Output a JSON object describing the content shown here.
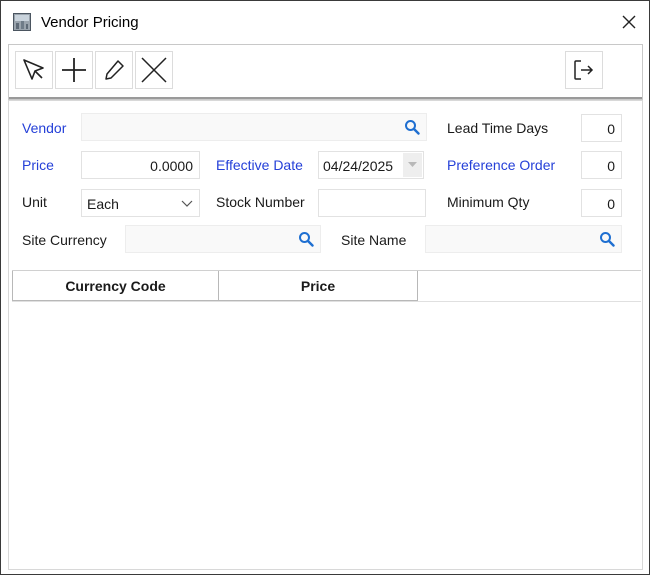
{
  "window": {
    "title": "Vendor Pricing"
  },
  "toolbar": {
    "icons": [
      "select-arrow-icon",
      "plus-icon",
      "pencil-icon",
      "x-delete-icon",
      "exit-icon"
    ]
  },
  "form": {
    "vendor": {
      "label": "Vendor",
      "value": ""
    },
    "lead_time_days": {
      "label": "Lead Time Days",
      "value": "0"
    },
    "price": {
      "label": "Price",
      "value": "0.0000"
    },
    "effective_date": {
      "label": "Effective Date",
      "value": "04/24/2025"
    },
    "preference_order": {
      "label": "Preference Order",
      "value": "0"
    },
    "unit": {
      "label": "Unit",
      "value": "Each"
    },
    "stock_number": {
      "label": "Stock Number",
      "value": ""
    },
    "minimum_qty": {
      "label": "Minimum Qty",
      "value": "0"
    },
    "site_currency": {
      "label": "Site Currency",
      "value": ""
    },
    "site_name": {
      "label": "Site Name",
      "value": ""
    }
  },
  "grid": {
    "columns": [
      "Currency Code",
      "Price"
    ],
    "rows": []
  },
  "colors": {
    "link_label": "#2540d8",
    "search_icon": "#1f6fd1"
  }
}
